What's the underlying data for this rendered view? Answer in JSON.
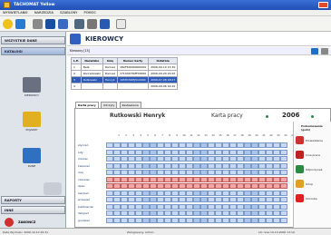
{
  "app": {
    "title": "TACHOMAT Yellow"
  },
  "menu": [
    "WYSWIETLANIE",
    "NARZEDZIA",
    "SZABLONY",
    "POMOC"
  ],
  "toolbar": {
    "icons": [
      "smile-icon",
      "save-icon",
      "wrench-icon",
      "card-icon",
      "card-icon",
      "people-icon",
      "printer-icon",
      "chart-icon",
      "info-icon"
    ]
  },
  "sidebar": {
    "top_button": "WSZYSTKIE DANE",
    "section_button": "KATALOGI",
    "items": [
      {
        "label": "KIEROWCY",
        "icon": "driver-icon"
      },
      {
        "label": "POJAZDY",
        "icon": "vehicle-icon"
      },
      {
        "label": "DANE",
        "icon": "card-reader-icon"
      }
    ],
    "raporty_button": "RAPORTY",
    "inne_button": "INNE",
    "exit_button": "ZAKONCZ"
  },
  "header": {
    "title": "KIEROWCY"
  },
  "addressbar": {
    "text": "Kierowcy [15]"
  },
  "drivers_table": {
    "columns": [
      "L.P.",
      "Nazwisko",
      "Imię",
      "Numer karty",
      "Ostatnie"
    ],
    "rows": [
      [
        "1",
        "Bala",
        "Dariusz",
        "18AFK000N000009",
        "2006-09-10 13:30"
      ],
      [
        "2",
        "Konradowski",
        "Dariusz",
        "17194475MF00000",
        "2006-09-29 22:00"
      ],
      [
        "3",
        "Rutkowski",
        "Henryk",
        "195H15RHJ510000",
        "2006-07-08 18:07"
      ],
      [
        "4",
        "",
        "",
        "",
        "2006-09-06 16:20"
      ]
    ],
    "selected_row": 2
  },
  "tabs": [
    "Karta pracy",
    "Odczyty",
    "Zestawienia"
  ],
  "card": {
    "name": "Rutkowski Henryk",
    "title": "Karta pracy",
    "year": "2006",
    "days": [
      "1",
      "2",
      "3",
      "4",
      "5",
      "6",
      "7",
      "8",
      "9",
      "10",
      "11",
      "12",
      "13",
      "14",
      "15",
      "16",
      "17",
      "18",
      "19",
      "20",
      "21",
      "22",
      "23",
      "24",
      "25",
      "26",
      "27",
      "28",
      "29",
      "30",
      "31"
    ],
    "months": [
      "styczeń",
      "luty",
      "marzec",
      "kwiecień",
      "maj",
      "czerwiec",
      "lipiec",
      "sierpień",
      "wrzesień",
      "październik",
      "listopad",
      "grudzień"
    ],
    "highlight_months": [
      5,
      6
    ],
    "legend_title": "Podsumowanie (godz)",
    "legend": [
      {
        "label": "Prowadzenie",
        "icon": "steering-icon",
        "color": "#d03030"
      },
      {
        "label": "Inna praca",
        "icon": "tools-icon",
        "color": "#c02020"
      },
      {
        "label": "Odpoczynek",
        "icon": "bed-icon",
        "color": "#2a8a40"
      },
      {
        "label": "Urlop",
        "icon": "vacation-icon",
        "color": "#e0a020"
      },
      {
        "label": "Choroba",
        "icon": "medical-icon",
        "color": "#e02020"
      }
    ]
  },
  "statusbar": {
    "left": "Data Wydruku: 2006.10.10 20:31",
    "center": "Zalogowany: Admin",
    "right": "LIC nres 10.10.2006 13:19"
  }
}
